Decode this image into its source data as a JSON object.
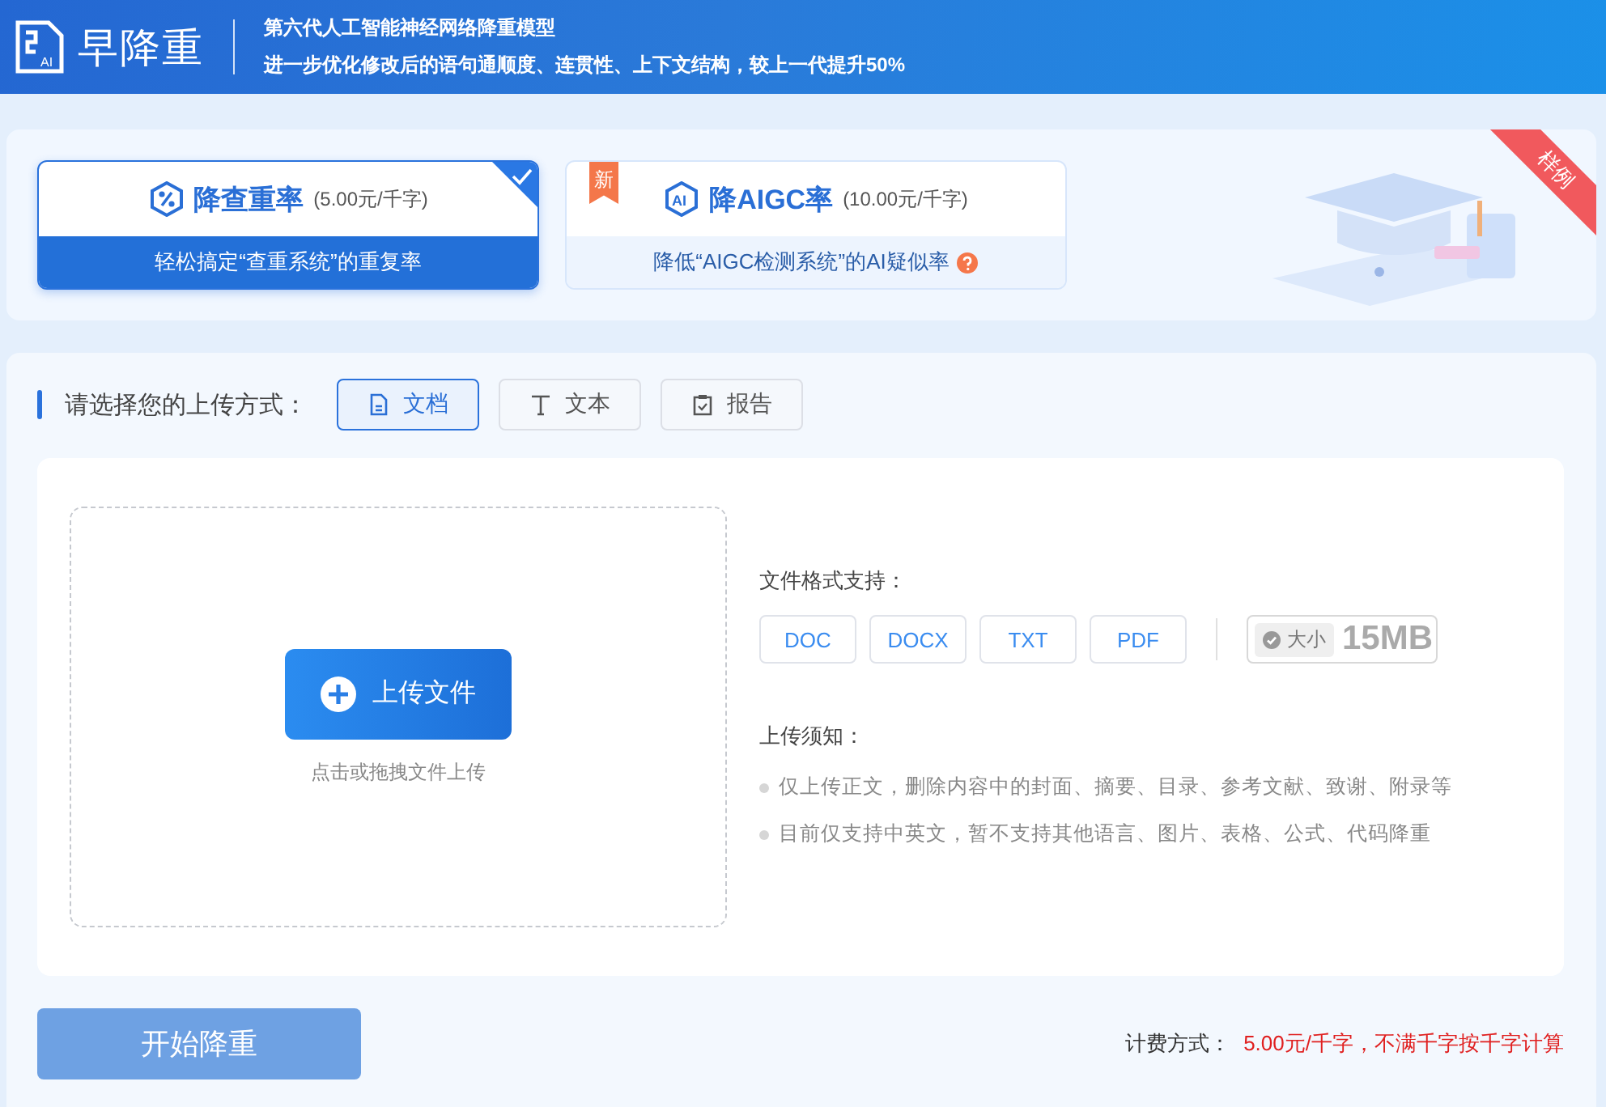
{
  "header": {
    "logo_badge": "AI",
    "logo": "早降重",
    "headline": "第六代人工智能神经网络降重模型",
    "subline": "进一步优化修改后的语句通顺度、连贯性、上下文结构，较上一代提升50%"
  },
  "modes": [
    {
      "kind": "percent",
      "title": "降查重率",
      "price": "(5.00元/千字)",
      "desc": "轻松搞定“查重系统”的重复率",
      "selected": true,
      "help": false
    },
    {
      "kind": "ai",
      "icon_label": "AI",
      "badge": "新",
      "title": "降AIGC率",
      "price": "(10.00元/千字)",
      "desc": "降低“AIGC检测系统”的AI疑似率",
      "selected": false,
      "help": true
    }
  ],
  "ribbon": "样例",
  "upload": {
    "label": "请选择您的上传方式：",
    "methods": [
      {
        "kind": "doc",
        "label": "文档",
        "selected": true
      },
      {
        "kind": "text",
        "label": "文本",
        "selected": false
      },
      {
        "kind": "clipboard",
        "label": "报告",
        "selected": false
      }
    ]
  },
  "dropzone": {
    "button": "上传文件",
    "hint": "点击或拖拽文件上传"
  },
  "formats": {
    "label": "文件格式支持：",
    "items": [
      "DOC",
      "DOCX",
      "TXT",
      "PDF"
    ],
    "size_label": "大小",
    "size": "15MB"
  },
  "notice": {
    "title": "上传须知：",
    "items": [
      "仅上传正文，删除内容中的封面、摘要、目录、参考文献、致谢、附录等",
      "目前仅支持中英文，暂不支持其他语言、图片、表格、公式、代码降重"
    ]
  },
  "footer": {
    "start": "开始降重",
    "price_label": "计费方式：",
    "price": "5.00元/千字，不满千字按千字计算"
  }
}
